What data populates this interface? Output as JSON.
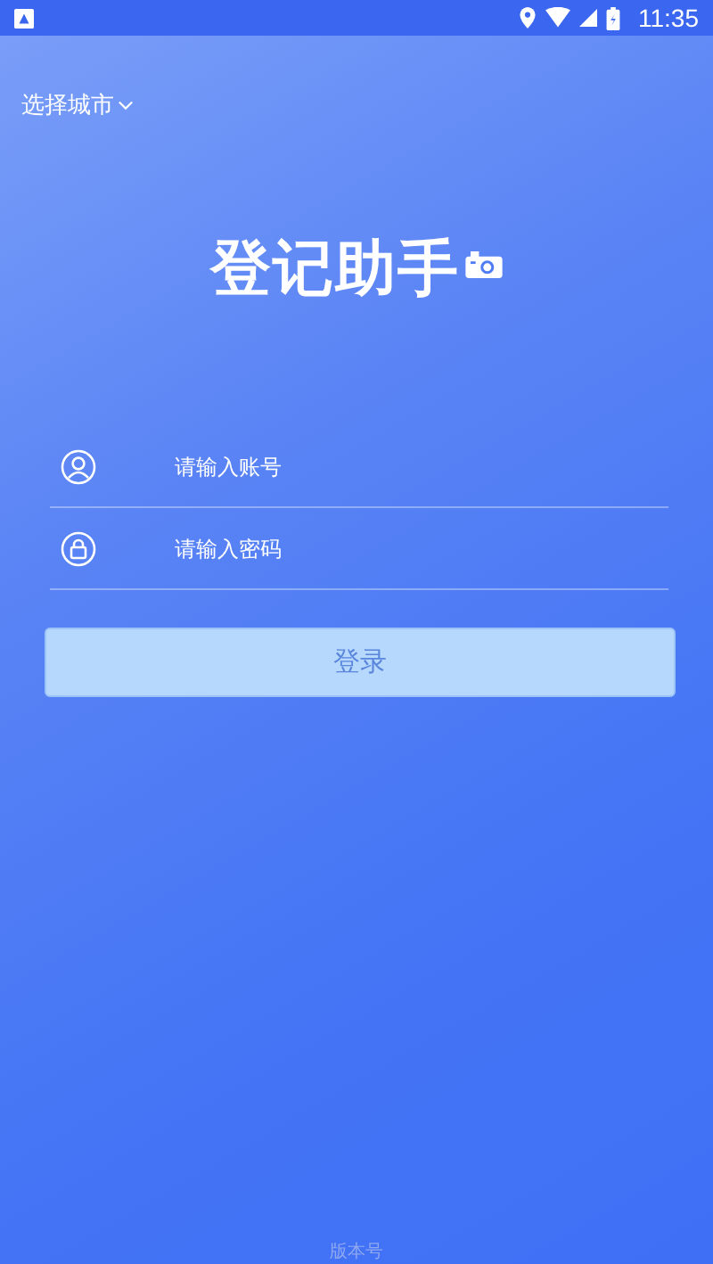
{
  "status_bar": {
    "time": "11:35"
  },
  "city_select": {
    "label": "选择城市"
  },
  "title": "登记助手",
  "fields": [
    {
      "kind": "account",
      "placeholder": "请输入账号"
    },
    {
      "kind": "password",
      "placeholder": "请输入密码"
    }
  ],
  "login_button": {
    "label": "登录",
    "disabled": true
  },
  "version": "版本号"
}
